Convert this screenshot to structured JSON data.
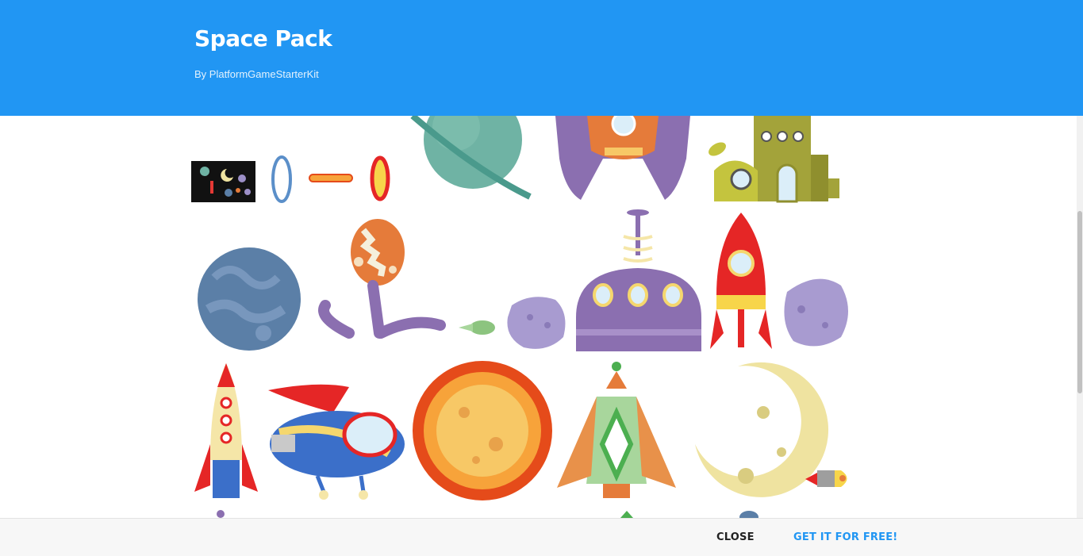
{
  "header": {
    "title": "Space Pack",
    "author": "By PlatformGameStarterKit",
    "background_color": "#2196f3"
  },
  "preview": {
    "sprites": [
      "thumbnail",
      "blue-portal",
      "orange-laser",
      "red-portal",
      "ringed-planet",
      "purple-spaceship",
      "yellow-space-station",
      "blue-planet",
      "alien-plant",
      "green-comet",
      "purple-asteroid",
      "purple-dome-station",
      "red-rocket",
      "purple-asteroid-2",
      "yellow-rocket",
      "flying-saucer",
      "sun",
      "green-spaceship",
      "moon",
      "small-rocket"
    ]
  },
  "footer": {
    "close_label": "CLOSE",
    "get_label": "GET IT FOR FREE!",
    "accent_color": "#2196f3"
  }
}
